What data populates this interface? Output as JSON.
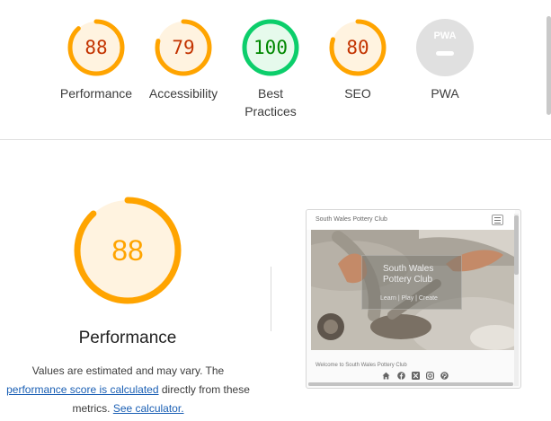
{
  "colors": {
    "average": "#ffa400",
    "average_text": "#c33300",
    "average_fill": "#fff3e0",
    "pass": "#0cce6b",
    "pass_text": "#008800",
    "pass_fill": "#e6faec",
    "na": "#e0e0e0",
    "link": "#1a5fb4"
  },
  "scores": [
    {
      "label": "Performance",
      "value": "88",
      "score": 0.88
    },
    {
      "label": "Accessibility",
      "value": "79",
      "score": 0.79
    },
    {
      "label_line1": "Best",
      "label_line2": "Practices",
      "value": "100",
      "score": 1.0
    },
    {
      "label": "SEO",
      "value": "80",
      "score": 0.8
    },
    {
      "label": "PWA",
      "badge_text": "PWA"
    }
  ],
  "detail": {
    "score": "88",
    "score_fraction": 0.88,
    "title": "Performance",
    "desc_part1": "Values are estimated and may vary. The",
    "desc_link1": "performance score is calculated",
    "desc_part2": " directly from these",
    "desc_part3": "metrics. ",
    "desc_link2": "See calculator."
  },
  "screenshot": {
    "site_name": "South Wales Pottery Club",
    "hero_title_line1": "South Wales",
    "hero_title_line2": "Pottery Club",
    "hero_links": "Learn | Play | Create",
    "welcome": "Welcome to South Wales Pottery Club",
    "icons": [
      "home-icon",
      "facebook-icon",
      "x-icon",
      "instagram-icon",
      "pinterest-icon"
    ]
  }
}
